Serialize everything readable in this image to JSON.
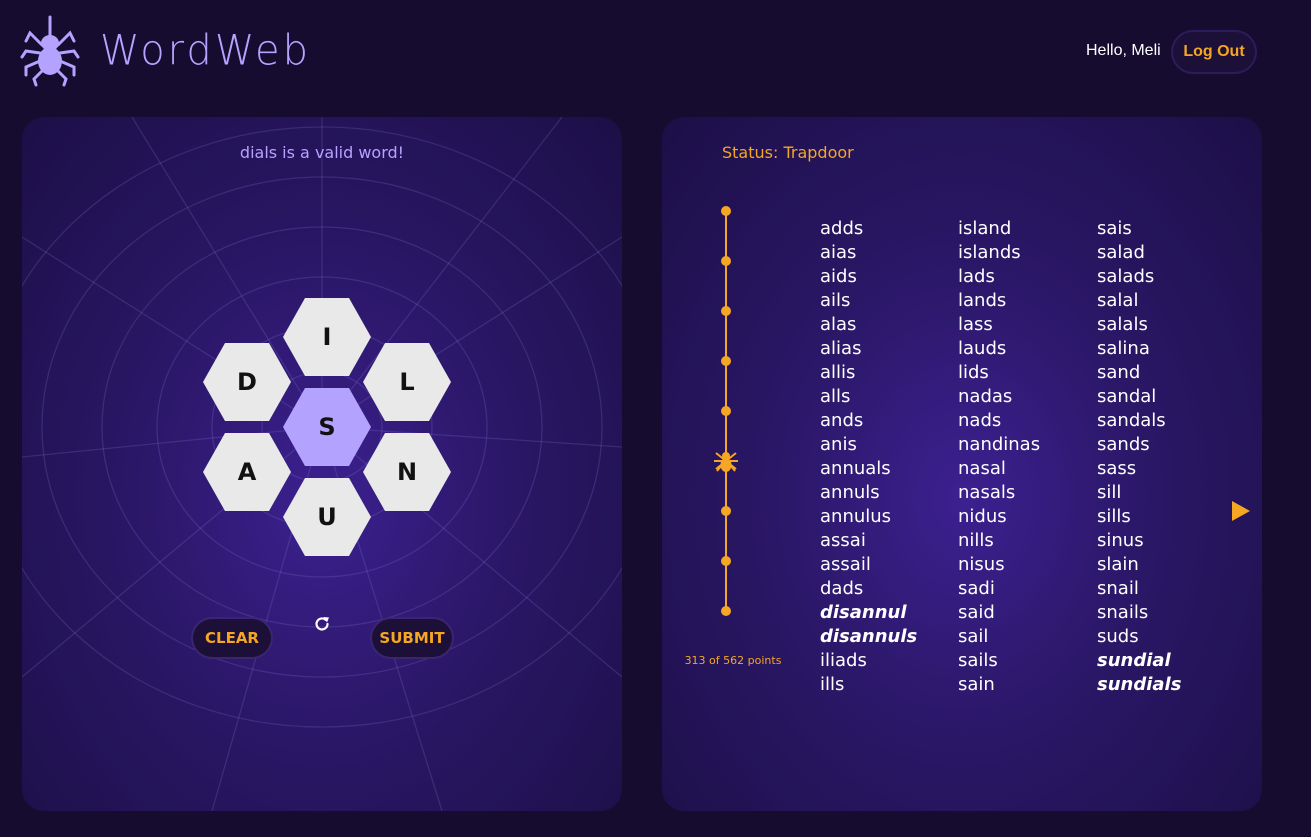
{
  "app": {
    "title": "WordWeb"
  },
  "user": {
    "greeting": "Hello, Meli",
    "logout_label": "Log Out"
  },
  "game": {
    "message": "dials is a valid word!",
    "letters": {
      "top": "I",
      "upper_left": "D",
      "upper_right": "L",
      "center": "S",
      "lower_left": "A",
      "lower_right": "N",
      "bottom": "U"
    },
    "clear_label": "CLEAR",
    "submit_label": "SUBMIT"
  },
  "progress": {
    "status_label": "Status: Trapdoor",
    "points_label": "313 of 562 points",
    "score": 313,
    "max_score": 562,
    "levels": 9,
    "current_level_index": 5
  },
  "colors": {
    "accent": "#f5a623",
    "lavender": "#b3a3ff",
    "background": "#150c30"
  },
  "found_words": {
    "col1": [
      {
        "text": "adds",
        "pangram": false
      },
      {
        "text": "aias",
        "pangram": false
      },
      {
        "text": "aids",
        "pangram": false
      },
      {
        "text": "ails",
        "pangram": false
      },
      {
        "text": "alas",
        "pangram": false
      },
      {
        "text": "alias",
        "pangram": false
      },
      {
        "text": "allis",
        "pangram": false
      },
      {
        "text": "alls",
        "pangram": false
      },
      {
        "text": "ands",
        "pangram": false
      },
      {
        "text": "anis",
        "pangram": false
      },
      {
        "text": "annuals",
        "pangram": false
      },
      {
        "text": "annuls",
        "pangram": false
      },
      {
        "text": "annulus",
        "pangram": false
      },
      {
        "text": "assai",
        "pangram": false
      },
      {
        "text": "assail",
        "pangram": false
      },
      {
        "text": "dads",
        "pangram": false
      },
      {
        "text": "disannul",
        "pangram": true
      },
      {
        "text": "disannuls",
        "pangram": true
      },
      {
        "text": "iliads",
        "pangram": false
      },
      {
        "text": "ills",
        "pangram": false
      }
    ],
    "col2": [
      {
        "text": "island",
        "pangram": false
      },
      {
        "text": "islands",
        "pangram": false
      },
      {
        "text": "lads",
        "pangram": false
      },
      {
        "text": "lands",
        "pangram": false
      },
      {
        "text": "lass",
        "pangram": false
      },
      {
        "text": "lauds",
        "pangram": false
      },
      {
        "text": "lids",
        "pangram": false
      },
      {
        "text": "nadas",
        "pangram": false
      },
      {
        "text": "nads",
        "pangram": false
      },
      {
        "text": "nandinas",
        "pangram": false
      },
      {
        "text": "nasal",
        "pangram": false
      },
      {
        "text": "nasals",
        "pangram": false
      },
      {
        "text": "nidus",
        "pangram": false
      },
      {
        "text": "nills",
        "pangram": false
      },
      {
        "text": "nisus",
        "pangram": false
      },
      {
        "text": "sadi",
        "pangram": false
      },
      {
        "text": "said",
        "pangram": false
      },
      {
        "text": "sail",
        "pangram": false
      },
      {
        "text": "sails",
        "pangram": false
      },
      {
        "text": "sain",
        "pangram": false
      }
    ],
    "col3": [
      {
        "text": "sais",
        "pangram": false
      },
      {
        "text": "salad",
        "pangram": false
      },
      {
        "text": "salads",
        "pangram": false
      },
      {
        "text": "salal",
        "pangram": false
      },
      {
        "text": "salals",
        "pangram": false
      },
      {
        "text": "salina",
        "pangram": false
      },
      {
        "text": "sand",
        "pangram": false
      },
      {
        "text": "sandal",
        "pangram": false
      },
      {
        "text": "sandals",
        "pangram": false
      },
      {
        "text": "sands",
        "pangram": false
      },
      {
        "text": "sass",
        "pangram": false
      },
      {
        "text": "sill",
        "pangram": false
      },
      {
        "text": "sills",
        "pangram": false
      },
      {
        "text": "sinus",
        "pangram": false
      },
      {
        "text": "slain",
        "pangram": false
      },
      {
        "text": "snail",
        "pangram": false
      },
      {
        "text": "snails",
        "pangram": false
      },
      {
        "text": "suds",
        "pangram": false
      },
      {
        "text": "sundial",
        "pangram": true
      },
      {
        "text": "sundials",
        "pangram": true
      }
    ]
  },
  "icons": {
    "logo": "spider-icon",
    "progress_marker": "spider-icon",
    "shuffle": "refresh-icon",
    "next_page": "play-arrow-icon"
  }
}
